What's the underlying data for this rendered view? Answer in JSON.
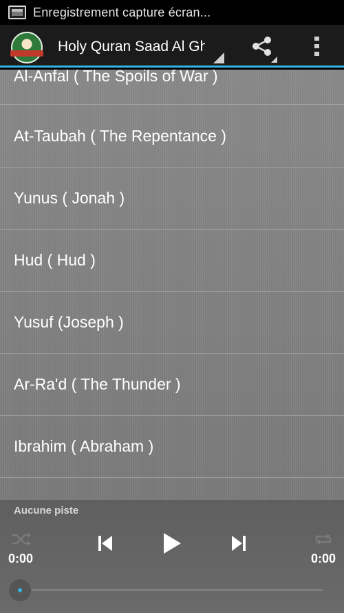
{
  "statusbar": {
    "notification_text": "Enregistrement capture écran..."
  },
  "actionbar": {
    "title": "Holy Quran Saad Al Ghamdi",
    "accent_color": "#33b5e5"
  },
  "surahs": [
    "Al-Anfal ( The Spoils of War )",
    "At-Taubah ( The Repentance )",
    "Yunus ( Jonah )",
    "Hud ( Hud )",
    "Yusuf (Joseph )",
    "Ar-Ra'd ( The Thunder )",
    "Ibrahim ( Abraham )"
  ],
  "player": {
    "track_label": "Aucune piste",
    "current_time": "0:00",
    "duration": "0:00",
    "progress": 0
  },
  "icons": {
    "share": "share-icon",
    "overflow": "overflow-menu-icon",
    "shuffle": "shuffle-icon",
    "repeat": "repeat-icon",
    "previous": "skip-previous-icon",
    "play": "play-icon",
    "next": "skip-next-icon"
  }
}
